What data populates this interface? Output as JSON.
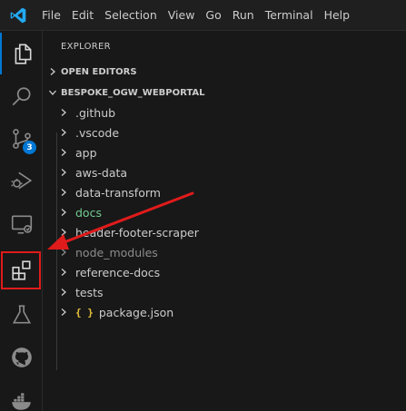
{
  "menu": [
    "File",
    "Edit",
    "Selection",
    "View",
    "Go",
    "Run",
    "Terminal",
    "Help"
  ],
  "activity_bar": {
    "items": [
      {
        "name": "explorer",
        "icon": "files-icon",
        "active": true
      },
      {
        "name": "search",
        "icon": "search-icon"
      },
      {
        "name": "source-control",
        "icon": "source-control-icon",
        "badge": "3"
      },
      {
        "name": "run-debug",
        "icon": "run-debug-icon"
      },
      {
        "name": "remote-explorer",
        "icon": "remote-explorer-icon"
      },
      {
        "name": "extensions",
        "icon": "extensions-icon",
        "highlighted": true
      },
      {
        "name": "testing",
        "icon": "flask-icon"
      },
      {
        "name": "github",
        "icon": "github-icon"
      },
      {
        "name": "docker",
        "icon": "docker-icon"
      }
    ],
    "source_control_badge": "3"
  },
  "explorer": {
    "title": "EXPLORER",
    "open_editors": "OPEN EDITORS",
    "workspace": "BESPOKE_OGW_WEBPORTAL",
    "tree": [
      {
        "label": ".github",
        "type": "folder"
      },
      {
        "label": ".vscode",
        "type": "folder"
      },
      {
        "label": "app",
        "type": "folder"
      },
      {
        "label": "aws-data",
        "type": "folder"
      },
      {
        "label": "data-transform",
        "type": "folder"
      },
      {
        "label": "docs",
        "type": "folder",
        "color": "#73c991"
      },
      {
        "label": "header-footer-scraper",
        "type": "folder"
      },
      {
        "label": "node_modules",
        "type": "folder",
        "color": "#8c8c8c"
      },
      {
        "label": "reference-docs",
        "type": "folder"
      },
      {
        "label": "tests",
        "type": "folder"
      },
      {
        "label": "package.json",
        "type": "file",
        "icon": "json-braces-icon"
      }
    ]
  },
  "colors": {
    "accent": "#0078d4",
    "annotation_red": "#e01b1b",
    "logo_blue": "#23a9f2",
    "json_icon": "#e8c33c"
  }
}
